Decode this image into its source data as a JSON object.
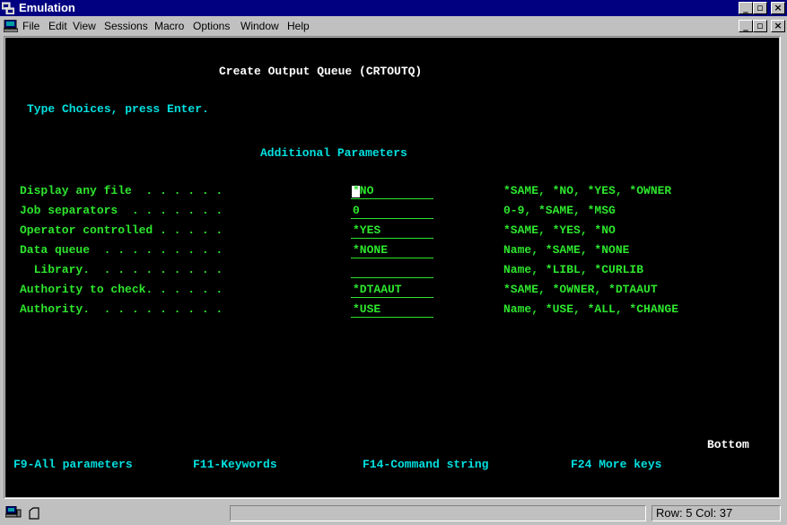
{
  "window": {
    "title": "Emulation"
  },
  "menu": [
    "File",
    "Edit",
    "View",
    "Sessions",
    "Macro",
    "Options",
    "Window",
    "Help"
  ],
  "screen": {
    "heading": "Create Output Queue (CRTOUTQ)",
    "instruction": "Type Choices, press Enter.",
    "section": "Additional Parameters",
    "params": [
      {
        "label": "Display any file  . . . . . .",
        "value": "*NO",
        "choices": "*SAME, *NO, *YES, *OWNER"
      },
      {
        "label": "Job separators  . . . . . . .",
        "value": "0",
        "choices": "0-9, *SAME, *MSG"
      },
      {
        "label": "Operator controlled . . . . .",
        "value": "*YES",
        "choices": "*SAME, *YES, *NO"
      },
      {
        "label": "Data queue  . . . . . . . . .",
        "value": "*NONE",
        "choices": "Name, *SAME, *NONE"
      },
      {
        "label": "  Library.  . . . . . . . . .",
        "value": "",
        "choices": "Name, *LIBL, *CURLIB"
      },
      {
        "label": "Authority to check. . . . . .",
        "value": "*DTAAUT",
        "choices": "*SAME, *OWNER, *DTAAUT"
      },
      {
        "label": "Authority.  . . . . . . . . .",
        "value": "*USE",
        "choices": "Name, *USE, *ALL, *CHANGE"
      }
    ],
    "bottom": "Bottom",
    "fkeys": [
      "F9-All parameters",
      "F11-Keywords",
      "F14-Command string",
      "F24 More keys"
    ]
  },
  "status": {
    "position": "Row: 5 Col: 37"
  },
  "colors": {
    "titlebar": "#000080",
    "screen_bg": "#000000",
    "field_text": "#2de62d",
    "heading_text": "#ffffff",
    "label_text": "#00e0e0"
  }
}
